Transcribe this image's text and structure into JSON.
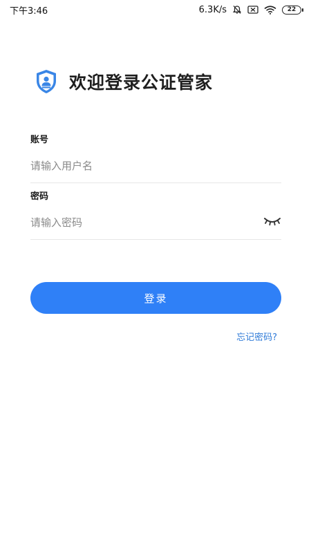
{
  "status_bar": {
    "time": "下午3:46",
    "network_speed": "6.3K/s",
    "battery": "22",
    "icons": [
      "mute-icon",
      "sim-off-icon",
      "wifi-icon",
      "battery-icon"
    ]
  },
  "header": {
    "logo_icon": "shield-user-icon",
    "title": "欢迎登录公证管家"
  },
  "form": {
    "account": {
      "label": "账号",
      "placeholder": "请输入用户名",
      "value": ""
    },
    "password": {
      "label": "密码",
      "placeholder": "请输入密码",
      "value": "",
      "toggle_icon": "eye-closed-icon"
    }
  },
  "login_button": {
    "label": "登录"
  },
  "forgot_password": {
    "label": "忘记密码?"
  },
  "colors": {
    "accent": "#2f80f7",
    "link": "#2f7bd8",
    "logo_blue": "#3a86e6",
    "divider": "#e6e6e6"
  }
}
